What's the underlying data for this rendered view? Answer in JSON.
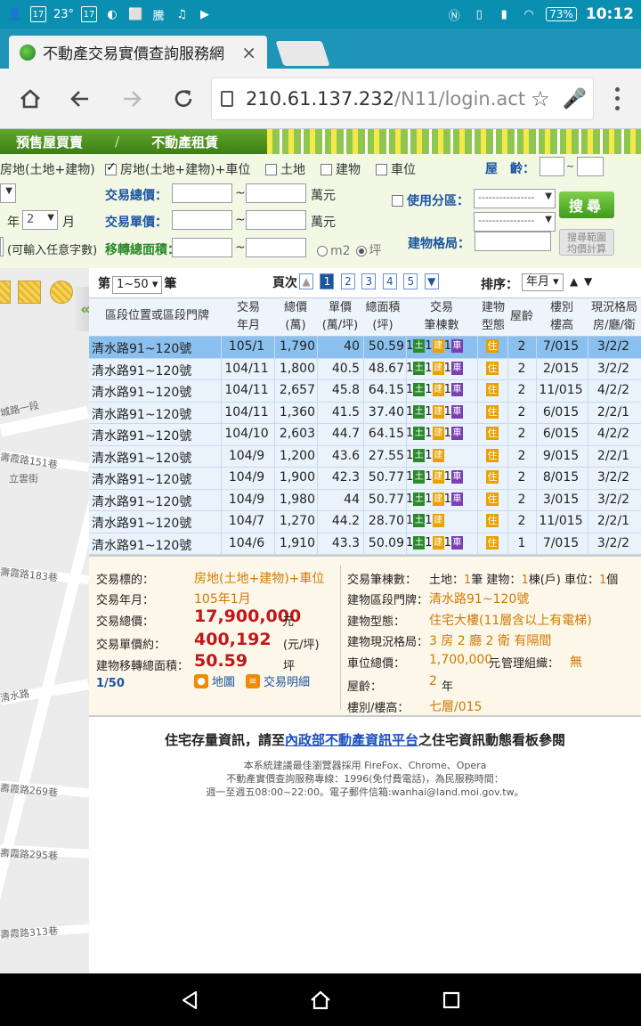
{
  "status": {
    "time": "10:12",
    "battery": "73%",
    "left_icons": [
      "17",
      "23°",
      "17",
      "騰"
    ]
  },
  "browser": {
    "tab_title": "不動產交易實價查詢服務網",
    "tab_close": "×",
    "url_main": "210.61.137.232",
    "url_path": "/N11/login.act"
  },
  "banner": {
    "menu": [
      "預售屋買賣",
      "/",
      "不動產租賃"
    ]
  },
  "form": {
    "opt_land_building": "房地(土地+建物)",
    "opt_land_building_parking": "房地(土地+建物)+車位",
    "opt_land": "土地",
    "opt_building": "建物",
    "opt_parking": "車位",
    "age_label": "屋　齡：",
    "tilde": "~",
    "total_price_label": "交易總價：",
    "unit_wan": "萬元",
    "unit_price_label": "交易單價：",
    "use_zone_label": "使用分區：",
    "zone_placeholder": "----------------",
    "zone_placeholder2": "----------------",
    "area_label": "移轉總面積：",
    "unit_m2": "m2",
    "unit_ping": "坪",
    "layout_label": "建物格局：",
    "year_label": "年",
    "month_value": "2",
    "month_label": "月",
    "any_chars_hint": "(可輸入任意字數)",
    "search_btn": "搜尋",
    "range_btn_1": "搜尋範圍",
    "range_btn_2": "均價計算"
  },
  "map": {
    "streets": [
      "城路一段",
      "壽霞路151巷",
      "立雲街",
      "壽霞路183巷",
      "清水路",
      "壽霞路269巷",
      "壽霞路295巷",
      "壽霞路313巷"
    ]
  },
  "results": {
    "page_prefix": "第",
    "page_range": "1~50",
    "page_suffix": "筆",
    "pages_label": "頁次",
    "pages": [
      "1",
      "2",
      "3",
      "4",
      "5"
    ],
    "sort_label": "排序：",
    "sort_value": "年月",
    "sort_up": "▲",
    "sort_down": "▼",
    "headers": {
      "address": "區段位置或區段門牌",
      "date_1": "交易",
      "date_2": "年月",
      "total_1": "總價",
      "total_2": "(萬)",
      "unit_1": "單價",
      "unit_2": "(萬/坪)",
      "area_1": "總面積",
      "area_2": "(坪)",
      "count_1": "交易",
      "count_2": "筆棟數",
      "type_1": "建物",
      "type_2": "型態",
      "age": "屋齡",
      "floor_1": "樓別",
      "floor_2": "樓高",
      "layout_1": "現況格局",
      "layout_2": "房/廳/衛"
    },
    "badge_land": "土",
    "badge_building": "建",
    "badge_parking": "車",
    "badge_res": "住",
    "rows": [
      {
        "address": "清水路91~120號",
        "date": "105/1",
        "total": "1,790",
        "unit": "40",
        "area": "50.59",
        "n1": "1",
        "n2": "1",
        "n3": "1",
        "parking": true,
        "age": "2",
        "floor": "7/015",
        "layout": "3/2/2"
      },
      {
        "address": "清水路91~120號",
        "date": "104/11",
        "total": "1,800",
        "unit": "40.5",
        "area": "48.67",
        "n1": "1",
        "n2": "1",
        "n3": "1",
        "parking": true,
        "age": "2",
        "floor": "2/015",
        "layout": "3/2/2"
      },
      {
        "address": "清水路91~120號",
        "date": "104/11",
        "total": "2,657",
        "unit": "45.8",
        "area": "64.15",
        "n1": "1",
        "n2": "1",
        "n3": "1",
        "parking": true,
        "age": "2",
        "floor": "11/015",
        "layout": "4/2/2"
      },
      {
        "address": "清水路91~120號",
        "date": "104/11",
        "total": "1,360",
        "unit": "41.5",
        "area": "37.40",
        "n1": "1",
        "n2": "1",
        "n3": "1",
        "parking": true,
        "age": "2",
        "floor": "6/015",
        "layout": "2/2/1"
      },
      {
        "address": "清水路91~120號",
        "date": "104/10",
        "total": "2,603",
        "unit": "44.7",
        "area": "64.15",
        "n1": "1",
        "n2": "1",
        "n3": "1",
        "parking": true,
        "age": "2",
        "floor": "6/015",
        "layout": "4/2/2"
      },
      {
        "address": "清水路91~120號",
        "date": "104/9",
        "total": "1,200",
        "unit": "43.6",
        "area": "27.55",
        "n1": "1",
        "n2": "1",
        "n3": "",
        "parking": false,
        "age": "2",
        "floor": "9/015",
        "layout": "2/2/1"
      },
      {
        "address": "清水路91~120號",
        "date": "104/9",
        "total": "1,900",
        "unit": "42.3",
        "area": "50.77",
        "n1": "1",
        "n2": "1",
        "n3": "1",
        "parking": true,
        "age": "2",
        "floor": "8/015",
        "layout": "3/2/2"
      },
      {
        "address": "清水路91~120號",
        "date": "104/9",
        "total": "1,980",
        "unit": "44",
        "area": "50.77",
        "n1": "1",
        "n2": "1",
        "n3": "1",
        "parking": true,
        "age": "2",
        "floor": "3/015",
        "layout": "3/2/2"
      },
      {
        "address": "清水路91~120號",
        "date": "104/7",
        "total": "1,270",
        "unit": "44.2",
        "area": "28.70",
        "n1": "1",
        "n2": "1",
        "n3": "",
        "parking": false,
        "age": "2",
        "floor": "11/015",
        "layout": "2/2/1"
      },
      {
        "address": "清水路91~120號",
        "date": "104/6",
        "total": "1,910",
        "unit": "43.3",
        "area": "50.09",
        "n1": "1",
        "n2": "1",
        "n3": "1",
        "parking": true,
        "age": "1",
        "floor": "7/015",
        "layout": "3/2/2"
      }
    ]
  },
  "detail": {
    "subject_k": "交易標的：",
    "subject_v": "房地(土地+建物)+車位",
    "date_k": "交易年月：",
    "date_v": "105年1月",
    "total_k": "交易總價：",
    "total_v": "17,900,000",
    "total_unit": "元",
    "unit_k": "交易單價約：",
    "unit_v": "400,192",
    "unit_unit": "(元/坪)",
    "area_k": "建物移轉總面積：",
    "area_v": "50.59",
    "area_unit": "坪",
    "pager": "1/50",
    "link_map": "地圖",
    "link_detail": "交易明細",
    "count_k": "交易筆棟數：",
    "count_land": "土地：",
    "count_land_n": "1",
    "count_land_u": "筆 建物：",
    "count_bld_n": "1",
    "count_bld_u": "棟(戶) 車位：",
    "count_park_n": "1",
    "count_park_u": "個",
    "addr_k": "建物區段門牌：",
    "addr_v": "清水路91~120號",
    "type_k": "建物型態：",
    "type_v": "住宅大樓(11層含以上有電梯)",
    "layout_k": "建物現況格局：",
    "layout_v": "3 房 2 廳 2 衛 有隔間",
    "park_k": "車位總價：",
    "park_v": "1,700,000",
    "park_unit": "元",
    "mgmt_k": "管理組織：",
    "mgmt_v": "無",
    "age_k": "屋齡：",
    "age_v": "2",
    "age_unit": "年",
    "floor_k": "樓別/樓高：",
    "floor_v": "七層/015"
  },
  "notice": {
    "pre": "住宅存量資訊，請至",
    "link": "內政部不動產資訊平台",
    "post": "之住宅資訊動態看板參閱"
  },
  "footer": {
    "line1": "本系統建議最佳瀏覽器採用 FireFox、Chrome、Opera",
    "line2": "不動產實價查詢服務專線：1996(免付費電話)，為民服務時間：",
    "line3": "週一至週五08:00~22:00。電子郵件信箱:wanhai@land.moi.gov.tw。"
  }
}
